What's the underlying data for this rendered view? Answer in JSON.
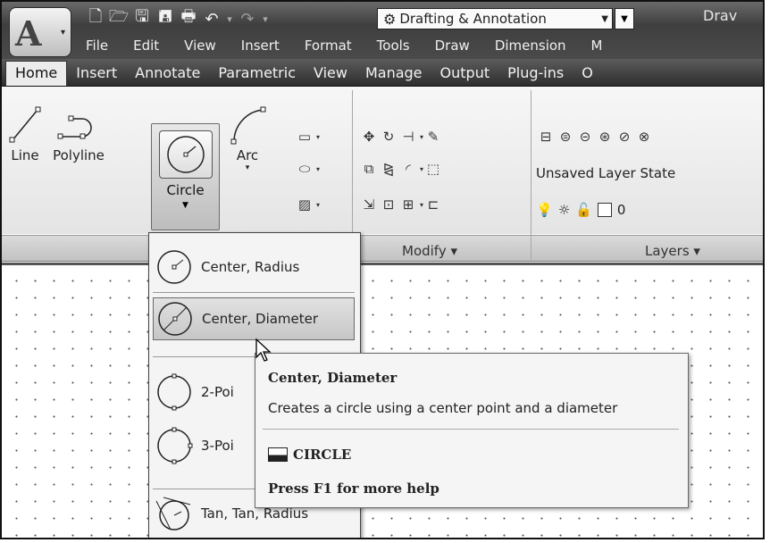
{
  "quick_access": {
    "workspace_label": "Drafting & Annotation",
    "doc_title": "Drav"
  },
  "menubar": [
    "File",
    "Edit",
    "View",
    "Insert",
    "Format",
    "Tools",
    "Draw",
    "Dimension",
    "M"
  ],
  "ribbon_tabs": [
    "Home",
    "Insert",
    "Annotate",
    "Parametric",
    "View",
    "Manage",
    "Output",
    "Plug-ins",
    "O"
  ],
  "draw_panel": {
    "line_label": "Line",
    "polyline_label": "Polyline",
    "circle_label": "Circle",
    "arc_label": "Arc"
  },
  "panels": {
    "modify_title": "Modify ▾",
    "layers_title": "Layers ▾"
  },
  "layers": {
    "layer_state": "Unsaved Layer State",
    "current_layer": "0"
  },
  "circle_menu": [
    {
      "label": "Center, Radius"
    },
    {
      "label": "Center, Diameter"
    },
    {
      "label": "2-Poi"
    },
    {
      "label": "3-Poi"
    },
    {
      "label": "Tan, Tan, Radius"
    }
  ],
  "tooltip": {
    "title": "Center, Diameter",
    "description": "Creates a circle using a center point and a diameter",
    "command": "CIRCLE",
    "help": "Press F1 for more help"
  }
}
